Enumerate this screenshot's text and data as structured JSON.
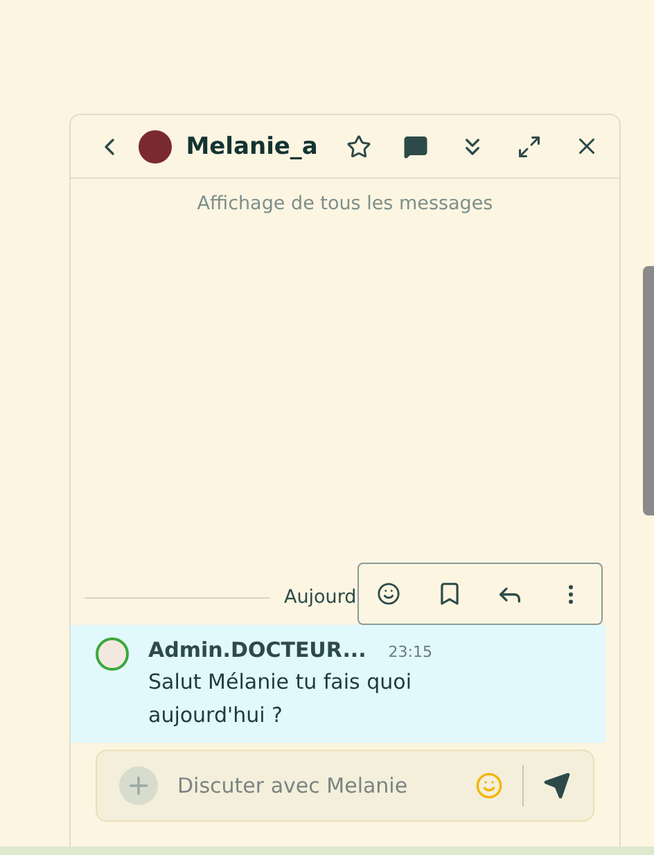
{
  "header": {
    "contact_name": "Melanie_a"
  },
  "notice": "Affichage de tous les messages",
  "date_divider": "Aujourd",
  "messages": [
    {
      "author": "Admin.DOCTEUR...",
      "time": "23:15",
      "text": "Salut Mélanie tu fais quoi aujourd'hui ?",
      "highlighted": true
    }
  ],
  "composer": {
    "placeholder": "Discuter avec Melanie"
  }
}
